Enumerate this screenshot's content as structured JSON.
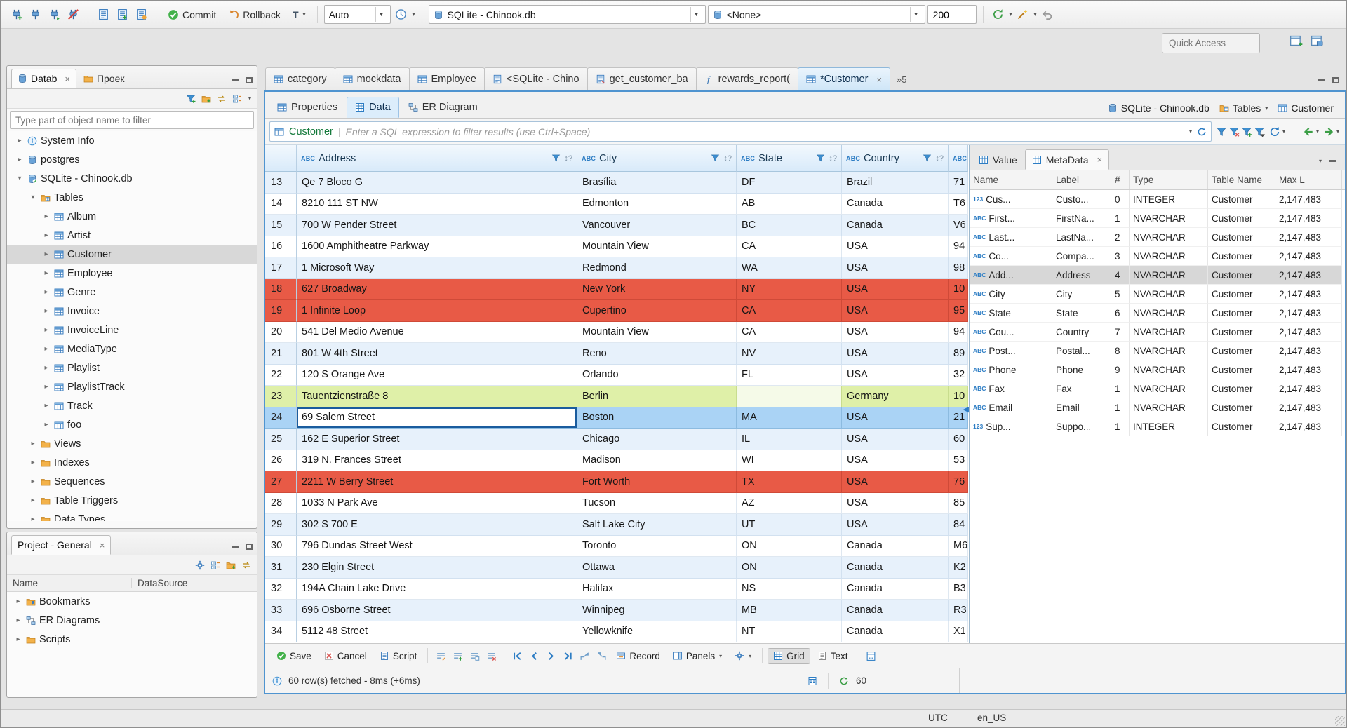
{
  "colors": {
    "accent_blue": "#2d7dc4",
    "row_error": "#e85a46",
    "row_success": "#dff0a8",
    "row_selected": "#aad3f5",
    "entity_green": "#157a3c"
  },
  "toolbar": {
    "commit_label": "Commit",
    "rollback_label": "Rollback",
    "txn_label": "T",
    "auto_commit_value": "Auto",
    "datasource_value": "SQLite - Chinook.db",
    "schema_value": "<None>",
    "fetch_size_value": "200",
    "quick_access_placeholder": "Quick Access"
  },
  "sidebar": {
    "tabs": [
      {
        "label": "Datab",
        "icon": "db",
        "active": true,
        "closable": true
      },
      {
        "label": "Проек",
        "icon": "folder",
        "active": false
      }
    ],
    "filter_placeholder": "Type part of object name to filter",
    "tree": [
      {
        "label": "System Info",
        "level": 0,
        "arrow": "collapsed",
        "icon": "info"
      },
      {
        "label": "postgres",
        "level": 0,
        "arrow": "collapsed",
        "icon": "db"
      },
      {
        "label": "SQLite - Chinook.db",
        "level": 0,
        "arrow": "expanded",
        "icon": "db-check"
      },
      {
        "label": "Tables",
        "level": 1,
        "arrow": "expanded",
        "icon": "folder-table"
      },
      {
        "label": "Album",
        "level": 2,
        "arrow": "collapsed",
        "icon": "table"
      },
      {
        "label": "Artist",
        "level": 2,
        "arrow": "collapsed",
        "icon": "table"
      },
      {
        "label": "Customer",
        "level": 2,
        "arrow": "collapsed",
        "icon": "table",
        "selected": true
      },
      {
        "label": "Employee",
        "level": 2,
        "arrow": "collapsed",
        "icon": "table"
      },
      {
        "label": "Genre",
        "level": 2,
        "arrow": "collapsed",
        "icon": "table"
      },
      {
        "label": "Invoice",
        "level": 2,
        "arrow": "collapsed",
        "icon": "table"
      },
      {
        "label": "InvoiceLine",
        "level": 2,
        "arrow": "collapsed",
        "icon": "table"
      },
      {
        "label": "MediaType",
        "level": 2,
        "arrow": "collapsed",
        "icon": "table"
      },
      {
        "label": "Playlist",
        "level": 2,
        "arrow": "collapsed",
        "icon": "table"
      },
      {
        "label": "PlaylistTrack",
        "level": 2,
        "arrow": "collapsed",
        "icon": "table"
      },
      {
        "label": "Track",
        "level": 2,
        "arrow": "collapsed",
        "icon": "table"
      },
      {
        "label": "foo",
        "level": 2,
        "arrow": "collapsed",
        "icon": "table"
      },
      {
        "label": "Views",
        "level": 1,
        "arrow": "collapsed",
        "icon": "folder"
      },
      {
        "label": "Indexes",
        "level": 1,
        "arrow": "collapsed",
        "icon": "folder"
      },
      {
        "label": "Sequences",
        "level": 1,
        "arrow": "collapsed",
        "icon": "folder"
      },
      {
        "label": "Table Triggers",
        "level": 1,
        "arrow": "collapsed",
        "icon": "folder"
      },
      {
        "label": "Data Types",
        "level": 1,
        "arrow": "collapsed",
        "icon": "folder"
      }
    ]
  },
  "project_panel": {
    "title": "Project - General",
    "columns": [
      "Name",
      "DataSource"
    ],
    "items": [
      {
        "label": "Bookmarks",
        "icon": "folder-bookmark"
      },
      {
        "label": "ER Diagrams",
        "icon": "er"
      },
      {
        "label": "Scripts",
        "icon": "folder"
      }
    ]
  },
  "editor_tabs": {
    "tabs": [
      {
        "label": "category",
        "icon": "table"
      },
      {
        "label": "mockdata",
        "icon": "table"
      },
      {
        "label": "Employee",
        "icon": "table"
      },
      {
        "label": "<SQLite - Chino",
        "icon": "sql"
      },
      {
        "label": "get_customer_ba",
        "icon": "sql-script"
      },
      {
        "label": "rewards_report(",
        "icon": "fn"
      },
      {
        "label": "*Customer",
        "icon": "table",
        "active": true,
        "closable": true
      }
    ],
    "overflow": "»5"
  },
  "result_tabs": [
    {
      "label": "Properties",
      "icon": "table"
    },
    {
      "label": "Data",
      "icon": "grid",
      "active": true
    },
    {
      "label": "ER Diagram",
      "icon": "er"
    }
  ],
  "breadcrumb": {
    "datasource": "SQLite - Chinook.db",
    "container": "Tables",
    "entity": "Customer"
  },
  "filter_bar": {
    "entity": "Customer",
    "placeholder": "Enter a SQL expression to filter results (use Ctrl+Space)"
  },
  "grid": {
    "sort_indicator": "↕?",
    "columns": [
      {
        "name": "Address",
        "type": "ABC"
      },
      {
        "name": "City",
        "type": "ABC"
      },
      {
        "name": "State",
        "type": "ABC"
      },
      {
        "name": "Country",
        "type": "ABC"
      },
      {
        "name": "",
        "type": "ABC"
      }
    ],
    "rows": [
      {
        "num": "13",
        "cells": [
          "Qe 7 Bloco G",
          "Brasília",
          "DF",
          "Brazil",
          "71"
        ],
        "style": "alt"
      },
      {
        "num": "14",
        "cells": [
          "8210 111 ST NW",
          "Edmonton",
          "AB",
          "Canada",
          "T6"
        ],
        "style": "plain"
      },
      {
        "num": "15",
        "cells": [
          "700 W Pender Street",
          "Vancouver",
          "BC",
          "Canada",
          "V6"
        ],
        "style": "alt"
      },
      {
        "num": "16",
        "cells": [
          "1600 Amphitheatre Parkway",
          "Mountain View",
          "CA",
          "USA",
          "94"
        ],
        "style": "plain"
      },
      {
        "num": "17",
        "cells": [
          "1 Microsoft Way",
          "Redmond",
          "WA",
          "USA",
          "98"
        ],
        "style": "alt"
      },
      {
        "num": "18",
        "cells": [
          "627 Broadway",
          "New York",
          "NY",
          "USA",
          "10"
        ],
        "style": "red"
      },
      {
        "num": "19",
        "cells": [
          "1 Infinite Loop",
          "Cupertino",
          "CA",
          "USA",
          "95"
        ],
        "style": "red"
      },
      {
        "num": "20",
        "cells": [
          "541 Del Medio Avenue",
          "Mountain View",
          "CA",
          "USA",
          "94"
        ],
        "style": "plain"
      },
      {
        "num": "21",
        "cells": [
          "801 W 4th Street",
          "Reno",
          "NV",
          "USA",
          "89"
        ],
        "style": "alt"
      },
      {
        "num": "22",
        "cells": [
          "120 S Orange Ave",
          "Orlando",
          "FL",
          "USA",
          "32"
        ],
        "style": "plain"
      },
      {
        "num": "23",
        "cells": [
          "Tauentzienstraße 8",
          "Berlin",
          "",
          "Germany",
          "10"
        ],
        "style": "green",
        "null_cell": 2
      },
      {
        "num": "24",
        "cells": [
          "69 Salem Street",
          "Boston",
          "MA",
          "USA",
          "21"
        ],
        "style": "selected",
        "focus_cell": 0
      },
      {
        "num": "25",
        "cells": [
          "162 E Superior Street",
          "Chicago",
          "IL",
          "USA",
          "60"
        ],
        "style": "alt"
      },
      {
        "num": "26",
        "cells": [
          "319 N. Frances Street",
          "Madison",
          "WI",
          "USA",
          "53"
        ],
        "style": "plain"
      },
      {
        "num": "27",
        "cells": [
          "2211 W Berry Street",
          "Fort Worth",
          "TX",
          "USA",
          "76"
        ],
        "style": "red"
      },
      {
        "num": "28",
        "cells": [
          "1033 N Park Ave",
          "Tucson",
          "AZ",
          "USA",
          "85"
        ],
        "style": "plain"
      },
      {
        "num": "29",
        "cells": [
          "302 S 700 E",
          "Salt Lake City",
          "UT",
          "USA",
          "84"
        ],
        "style": "alt"
      },
      {
        "num": "30",
        "cells": [
          "796 Dundas Street West",
          "Toronto",
          "ON",
          "Canada",
          "M6"
        ],
        "style": "plain"
      },
      {
        "num": "31",
        "cells": [
          "230 Elgin Street",
          "Ottawa",
          "ON",
          "Canada",
          "K2"
        ],
        "style": "alt"
      },
      {
        "num": "32",
        "cells": [
          "194A Chain Lake Drive",
          "Halifax",
          "NS",
          "Canada",
          "B3"
        ],
        "style": "plain"
      },
      {
        "num": "33",
        "cells": [
          "696 Osborne Street",
          "Winnipeg",
          "MB",
          "Canada",
          "R3"
        ],
        "style": "alt"
      },
      {
        "num": "34",
        "cells": [
          "5112 48 Street",
          "Yellowknife",
          "NT",
          "Canada",
          "X1"
        ],
        "style": "plain"
      }
    ]
  },
  "side_panel": {
    "tabs": [
      {
        "label": "Value",
        "icon": "grid"
      },
      {
        "label": "MetaData",
        "icon": "grid",
        "active": true,
        "closable": true
      }
    ],
    "metadata": {
      "columns": [
        "Name",
        "Label",
        "#",
        "Type",
        "Table Name",
        "Max L"
      ],
      "rows": [
        {
          "type_icon": "123",
          "name": "Cus...",
          "label": "Custo...",
          "ord": "0",
          "type": "INTEGER",
          "table": "Customer",
          "max": "2,147,483"
        },
        {
          "type_icon": "ABC",
          "name": "First...",
          "label": "FirstNa...",
          "ord": "1",
          "type": "NVARCHAR",
          "table": "Customer",
          "max": "2,147,483"
        },
        {
          "type_icon": "ABC",
          "name": "Last...",
          "label": "LastNa...",
          "ord": "2",
          "type": "NVARCHAR",
          "table": "Customer",
          "max": "2,147,483"
        },
        {
          "type_icon": "ABC",
          "name": "Co...",
          "label": "Compa...",
          "ord": "3",
          "type": "NVARCHAR",
          "table": "Customer",
          "max": "2,147,483"
        },
        {
          "type_icon": "ABC",
          "name": "Add...",
          "label": "Address",
          "ord": "4",
          "type": "NVARCHAR",
          "table": "Customer",
          "max": "2,147,483",
          "selected": true
        },
        {
          "type_icon": "ABC",
          "name": "City",
          "label": "City",
          "ord": "5",
          "type": "NVARCHAR",
          "table": "Customer",
          "max": "2,147,483"
        },
        {
          "type_icon": "ABC",
          "name": "State",
          "label": "State",
          "ord": "6",
          "type": "NVARCHAR",
          "table": "Customer",
          "max": "2,147,483"
        },
        {
          "type_icon": "ABC",
          "name": "Cou...",
          "label": "Country",
          "ord": "7",
          "type": "NVARCHAR",
          "table": "Customer",
          "max": "2,147,483"
        },
        {
          "type_icon": "ABC",
          "name": "Post...",
          "label": "Postal...",
          "ord": "8",
          "type": "NVARCHAR",
          "table": "Customer",
          "max": "2,147,483"
        },
        {
          "type_icon": "ABC",
          "name": "Phone",
          "label": "Phone",
          "ord": "9",
          "type": "NVARCHAR",
          "table": "Customer",
          "max": "2,147,483"
        },
        {
          "type_icon": "ABC",
          "name": "Fax",
          "label": "Fax",
          "ord": "1",
          "type": "NVARCHAR",
          "table": "Customer",
          "max": "2,147,483"
        },
        {
          "type_icon": "ABC",
          "name": "Email",
          "label": "Email",
          "ord": "1",
          "type": "NVARCHAR",
          "table": "Customer",
          "max": "2,147,483"
        },
        {
          "type_icon": "123",
          "name": "Sup...",
          "label": "Suppo...",
          "ord": "1",
          "type": "INTEGER",
          "table": "Customer",
          "max": "2,147,483"
        }
      ]
    }
  },
  "grid_toolbar": {
    "save": "Save",
    "cancel": "Cancel",
    "script": "Script",
    "record": "Record",
    "panels": "Panels",
    "grid": "Grid",
    "text": "Text"
  },
  "status": {
    "message": "60 row(s) fetched - 8ms (+6ms)",
    "refresh_count": "60"
  },
  "statusbar": {
    "timezone": "UTC",
    "locale": "en_US"
  }
}
